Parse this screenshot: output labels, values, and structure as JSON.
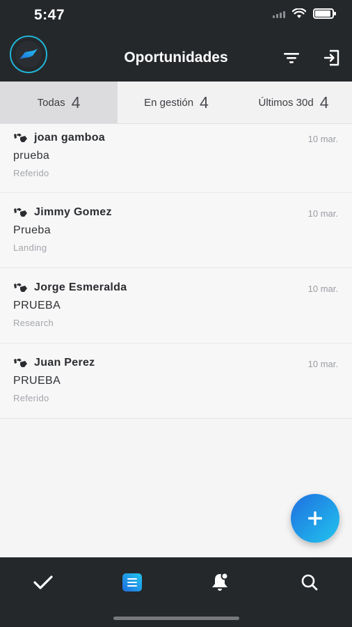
{
  "status_bar": {
    "time": "5:47"
  },
  "header": {
    "title": "Oportunidades"
  },
  "tabs": [
    {
      "label": "Todas",
      "count": "4"
    },
    {
      "label": "En gestión",
      "count": "4"
    },
    {
      "label": "Últimos 30d",
      "count": "4"
    }
  ],
  "items": [
    {
      "name": "joan gamboa",
      "date": "10 mar.",
      "subject": "prueba",
      "source": "Referido"
    },
    {
      "name": "Jimmy Gomez",
      "date": "10 mar.",
      "subject": "Prueba",
      "source": "Landing"
    },
    {
      "name": "Jorge Esmeralda",
      "date": "10 mar.",
      "subject": "PRUEBA",
      "source": "Research"
    },
    {
      "name": "Juan Perez",
      "date": "10 mar.",
      "subject": "PRUEBA",
      "source": "Referido"
    }
  ],
  "colors": {
    "bar_background": "#25282b",
    "accent_start": "#1e6fe0",
    "accent_end": "#22c4ee",
    "active_tab": "#dcdcde"
  },
  "icons": {
    "header_left": "app-logo",
    "header_right": [
      "filter-icon",
      "logout-icon"
    ],
    "item_icon": "handshake-icon",
    "fab": "plus-icon",
    "bottom_nav": [
      "check-icon",
      "list-icon",
      "bell-icon",
      "search-icon"
    ]
  }
}
